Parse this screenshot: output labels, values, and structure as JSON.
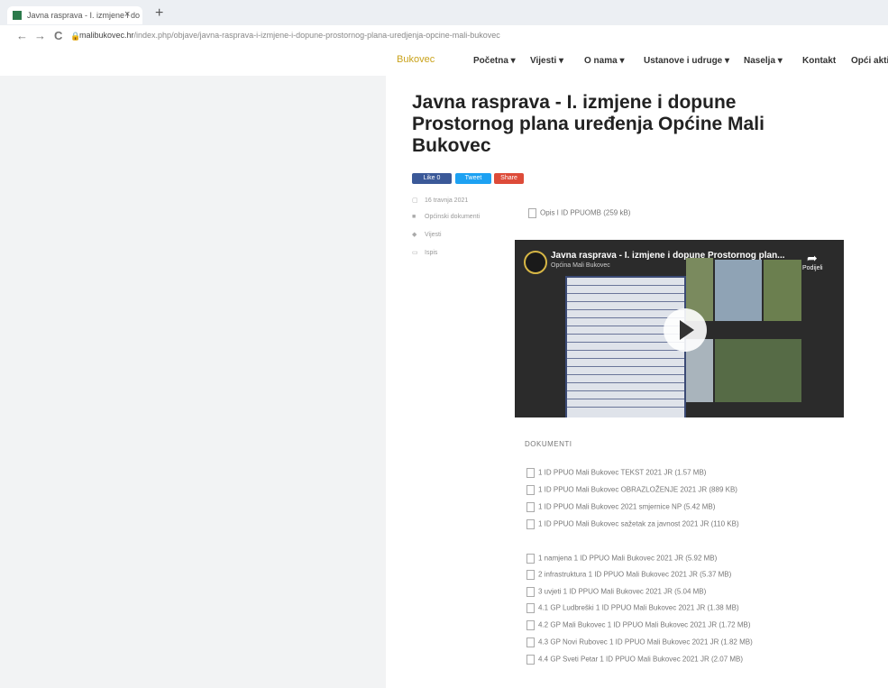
{
  "browser": {
    "tab_title": "Javna rasprava - I. izmjene i do",
    "tab_close": "×",
    "new_tab": "+",
    "back": "←",
    "forward": "→",
    "reload": "C",
    "url_domain": "malibukovec.hr",
    "url_path": "/index.php/objave/javna-rasprava-i-izmjene-i-dopune-prostornog-plana-uredjenja-opcine-mali-bukovec"
  },
  "site_nav": {
    "logo": "Bukovec",
    "items": [
      "Početna ▾",
      "Vijesti ▾",
      "O nama ▾",
      "Ustanove i udruge ▾",
      "Naselja ▾",
      "Kontakt",
      "Opći akti"
    ]
  },
  "article": {
    "title": "Javna rasprava - I. izmjene i dopune Prostornog plana uređenja Općine Mali Bukovec",
    "share_buttons": [
      "Like 0",
      "Tweet",
      "Share"
    ],
    "meta": [
      "16 travnja 2021",
      "Općinski dokumenti",
      "Vijesti",
      "Ispis"
    ],
    "intro_doc": "Opis I ID PPUOMB (259 kB)"
  },
  "video": {
    "title": "Javna rasprava - I. izmjene i dopune Prostornog plan...",
    "channel": "Općina Mali Bukovec",
    "share_label": "Podijeli"
  },
  "documents": {
    "heading": "DOKUMENTI",
    "group1": [
      "1 ID PPUO Mali Bukovec TEKST 2021 JR (1.57 MB)",
      "1 ID PPUO Mali Bukovec OBRAZLOŽENJE 2021 JR (889 KB)",
      "1 ID PPUO Mali Bukovec 2021 smjernice NP (5.42 MB)",
      "1 ID PPUO Mali Bukovec sažetak za javnost 2021 JR (110 KB)"
    ],
    "group2": [
      "1 namjena 1 ID PPUO Mali Bukovec 2021 JR (5.92 MB)",
      "2 infrastruktura 1 ID PPUO Mali Bukovec 2021 JR (5.37 MB)",
      "3 uvjeti 1 ID PPUO Mali Bukovec 2021 JR (5.04 MB)",
      "4.1 GP Ludbreški 1 ID PPUO Mali Bukovec 2021 JR (1.38 MB)",
      "4.2 GP Mali Bukovec 1 ID PPUO Mali Bukovec 2021 JR (1.72 MB)",
      "4.3 GP Novi Rubovec 1 ID PPUO Mali Bukovec 2021 JR (1.82 MB)",
      "4.4 GP Sveti Petar 1 ID PPUO Mali Bukovec 2021 JR (2.07 MB)"
    ]
  },
  "colors": {
    "brand": "#c9a21a",
    "facebook": "#3b5998",
    "twitter": "#1da1f2",
    "gplus": "#dd4b39"
  }
}
